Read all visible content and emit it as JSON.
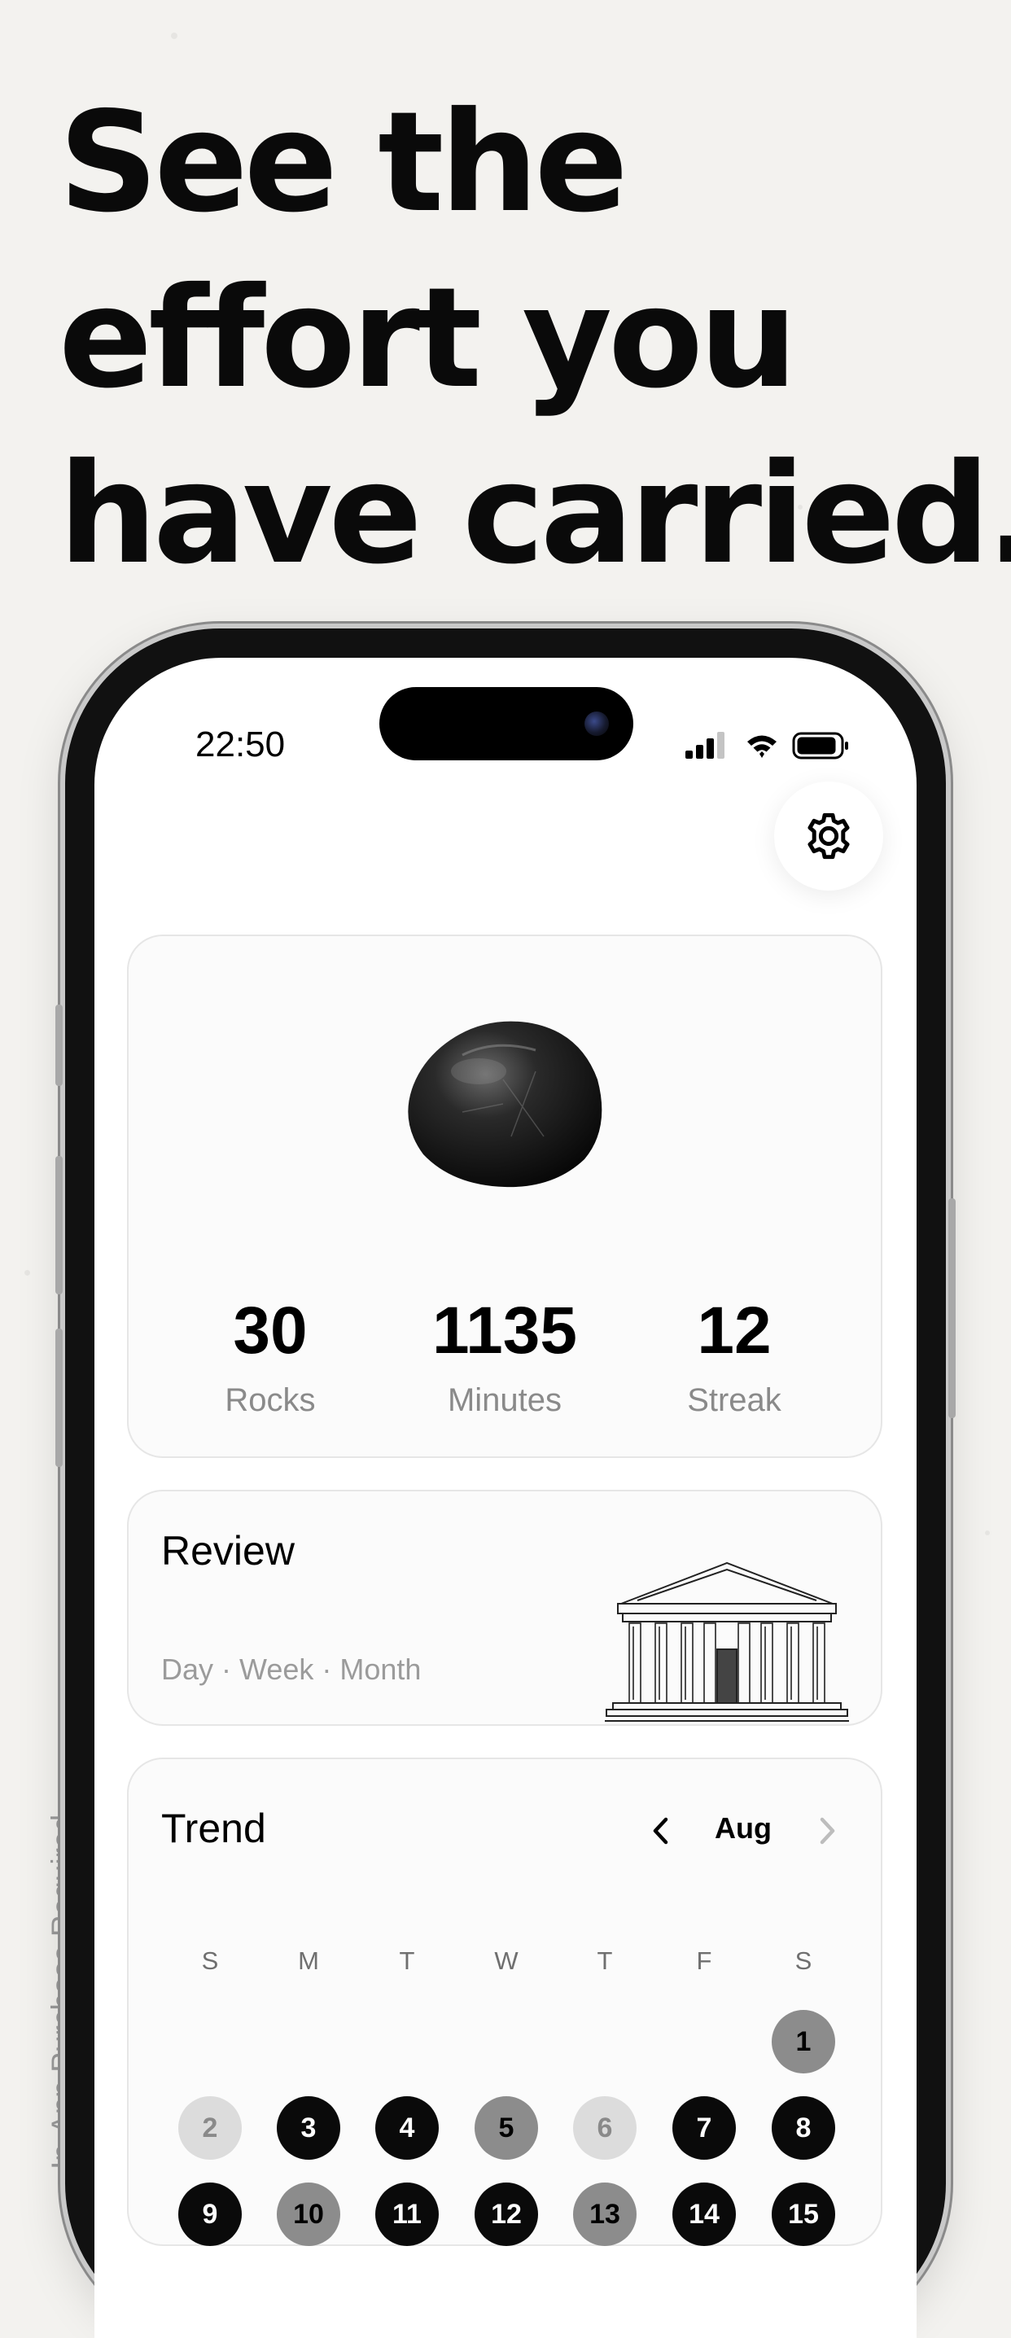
{
  "headline": [
    "See the",
    "effort you",
    "have carried."
  ],
  "disclaimer": "In-App Purchase Required",
  "status_bar": {
    "time": "22:50"
  },
  "stats": [
    {
      "value": "30",
      "label": "Rocks"
    },
    {
      "value": "1135",
      "label": "Minutes"
    },
    {
      "value": "12",
      "label": "Streak"
    }
  ],
  "review": {
    "title": "Review",
    "subtitle": "Day · Week · Month"
  },
  "trend": {
    "title": "Trend",
    "month": "Aug",
    "weekdays": [
      "S",
      "M",
      "T",
      "W",
      "T",
      "F",
      "S"
    ],
    "days": [
      {
        "n": "1",
        "level": "mid"
      },
      {
        "n": "2",
        "level": "light"
      },
      {
        "n": "3",
        "level": "black"
      },
      {
        "n": "4",
        "level": "black"
      },
      {
        "n": "5",
        "level": "mid"
      },
      {
        "n": "6",
        "level": "light"
      },
      {
        "n": "7",
        "level": "black"
      },
      {
        "n": "8",
        "level": "black"
      },
      {
        "n": "9",
        "level": "black"
      },
      {
        "n": "10",
        "level": "mid"
      },
      {
        "n": "11",
        "level": "black"
      },
      {
        "n": "12",
        "level": "black"
      },
      {
        "n": "13",
        "level": "mid"
      },
      {
        "n": "14",
        "level": "black"
      },
      {
        "n": "15",
        "level": "black"
      }
    ]
  },
  "icons": [
    "gear-icon",
    "chevron-left-icon",
    "chevron-right-icon",
    "signal-icon",
    "wifi-icon",
    "battery-icon",
    "rock-image",
    "temple-illustration"
  ]
}
